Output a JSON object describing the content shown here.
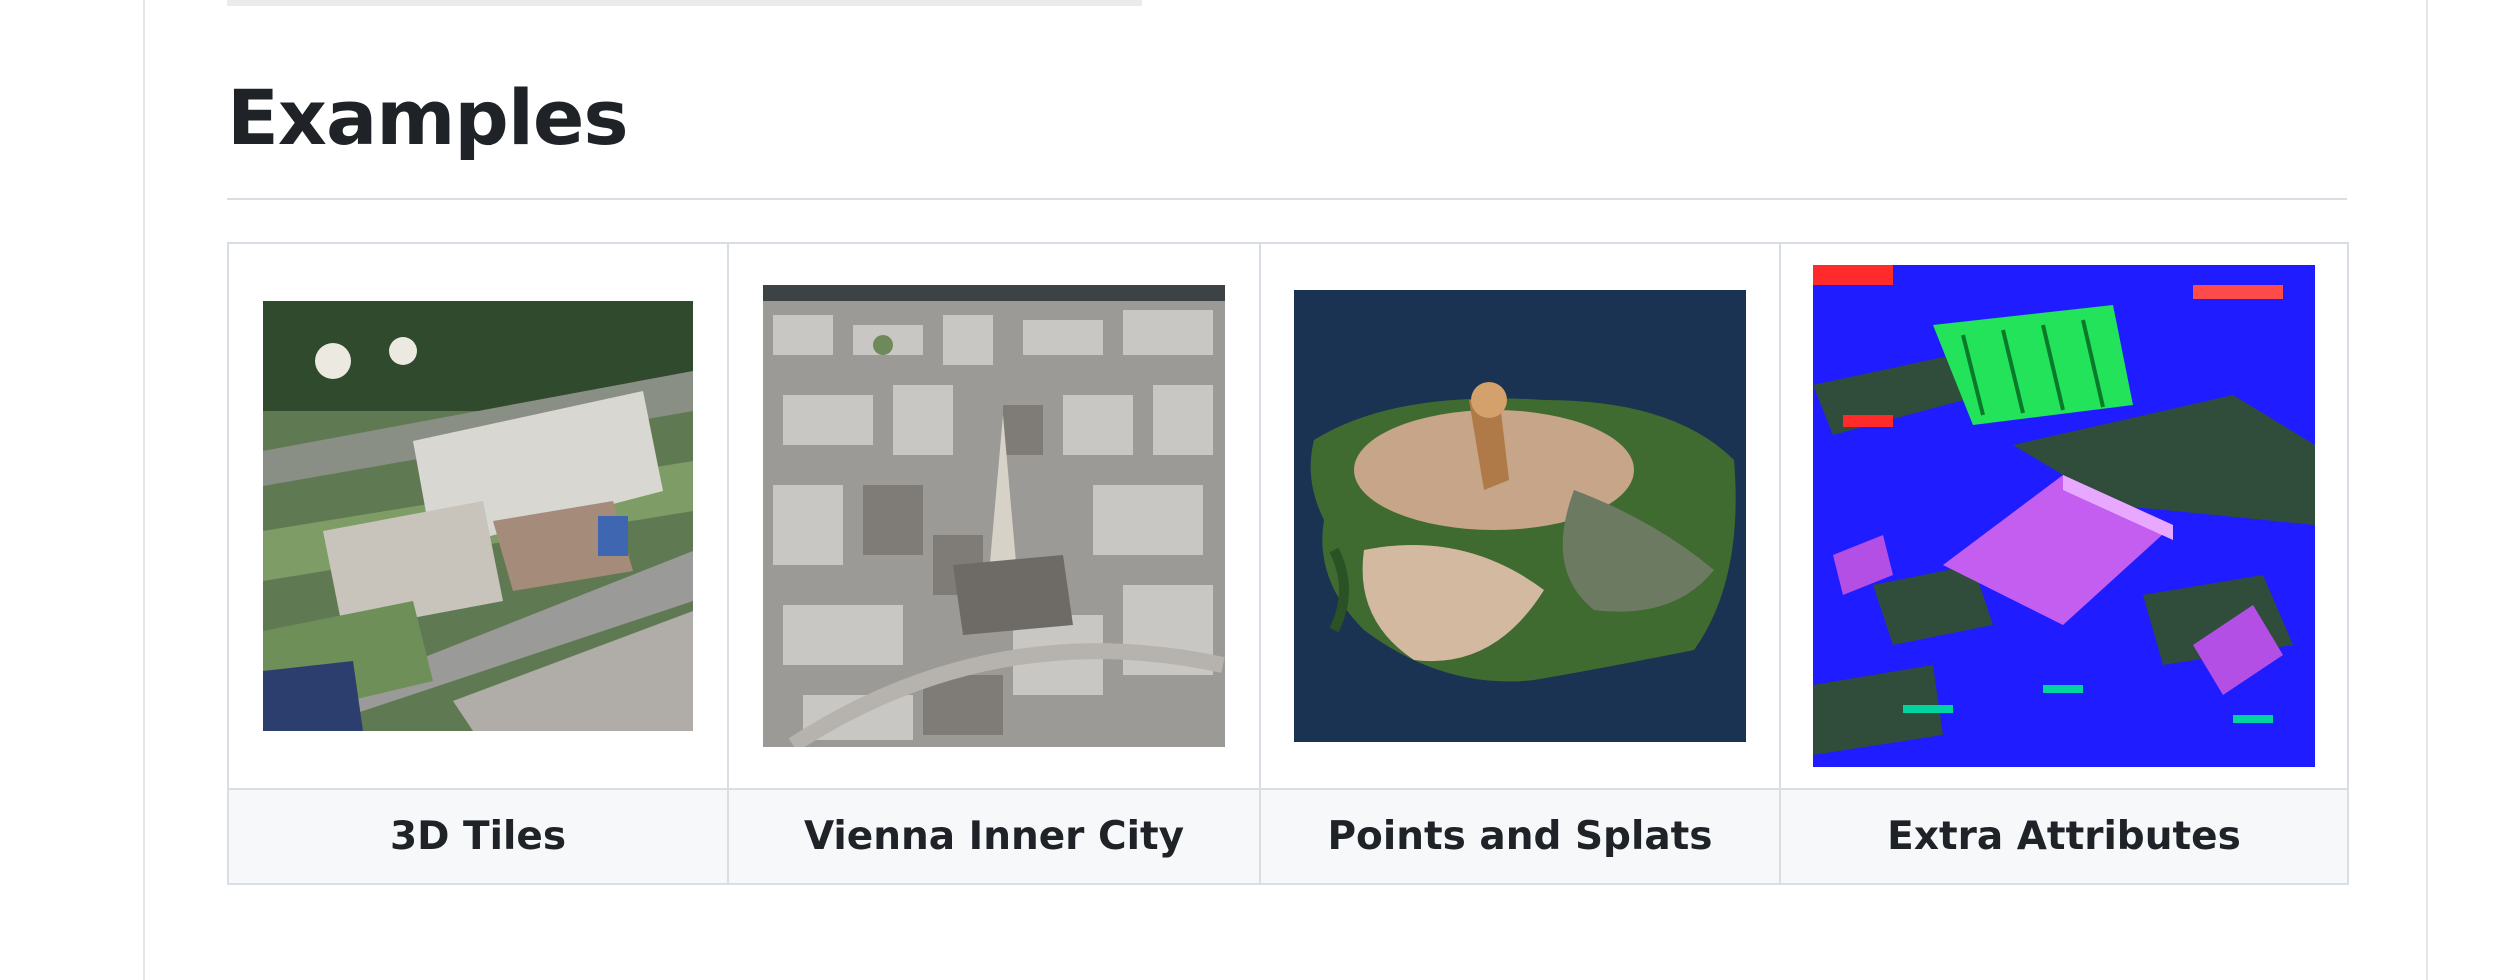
{
  "section": {
    "heading": "Examples"
  },
  "examples": [
    {
      "label": "3D Tiles",
      "thumb": "aerial-campus-tiles"
    },
    {
      "label": "Vienna Inner City",
      "thumb": "vienna-city-aerial"
    },
    {
      "label": "Points and Splats",
      "thumb": "point-cloud-island"
    },
    {
      "label": "Extra Attributes",
      "thumb": "normal-map-city"
    }
  ],
  "colors": {
    "text": "#1f2328",
    "border": "#d8dee4",
    "caption_bg": "#f6f8fa",
    "points_bg": "#1b3352",
    "normals_blue": "#1f1cff"
  }
}
